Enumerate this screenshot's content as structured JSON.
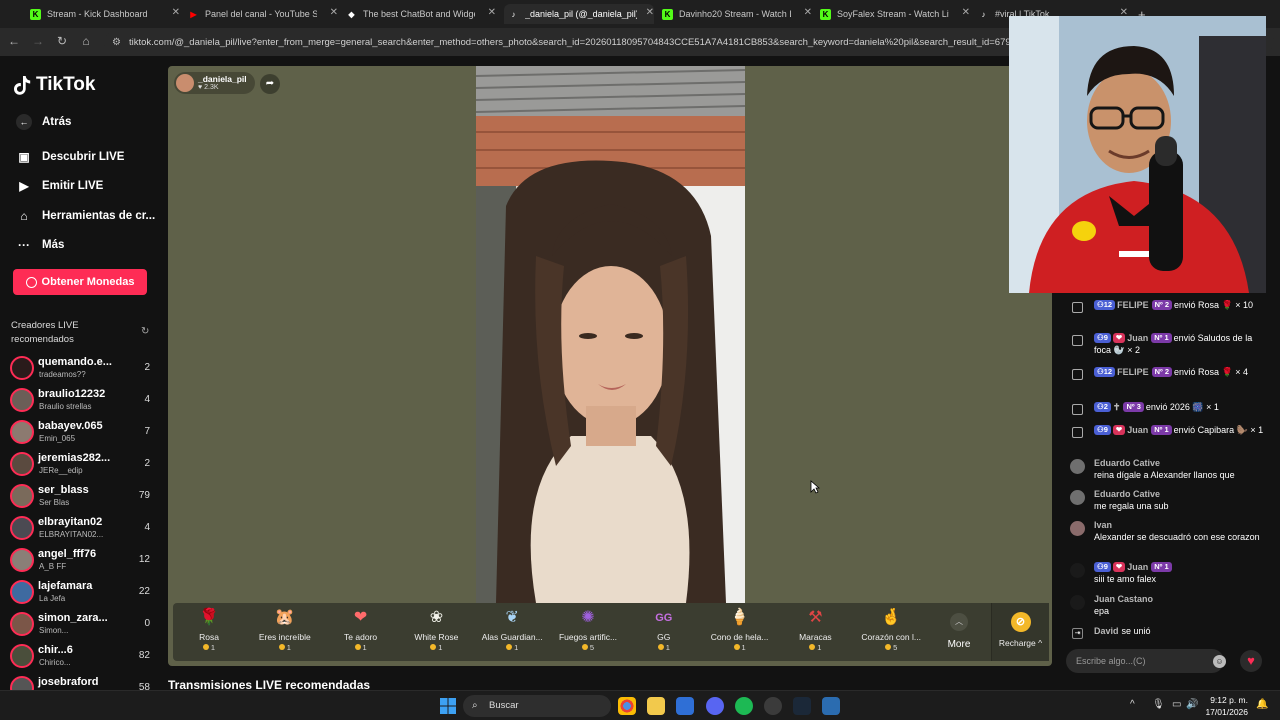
{
  "browser": {
    "tabs": [
      {
        "title": "Stream - Kick Dashboard",
        "icon": "kick-icon",
        "color": "#53fc18"
      },
      {
        "title": "Panel del canal - YouTube Studio",
        "icon": "youtube-icon",
        "color": "#ff0000"
      },
      {
        "title": "The best ChatBot and Widgets",
        "icon": "streamelements-icon",
        "color": "#ffffff"
      },
      {
        "title": "_daniela_pil (@_daniela_pil)",
        "icon": "tiktok-icon",
        "color": "#ffffff"
      },
      {
        "title": "Davinho20 Stream - Watch Live",
        "icon": "kick-icon",
        "color": "#53fc18"
      },
      {
        "title": "SoyFalex Stream - Watch Live o",
        "icon": "kick-icon",
        "color": "#53fc18"
      },
      {
        "title": "#viral | TikTok",
        "icon": "tiktok-icon",
        "color": "#ffffff"
      }
    ],
    "new_tab": "+",
    "url": "tiktok.com/@_daniela_pil/live?enter_from_merge=general_search&enter_method=others_photo&search_id=20260118095704843CCE51A7A4181CB853&search_keyword=daniela%20pil&search_result_id=679591156"
  },
  "sidebar": {
    "logo": "TikTok",
    "back": "Atrás",
    "nav": [
      {
        "label": "Descubrir LIVE",
        "icon": "live-tv-icon"
      },
      {
        "label": "Emitir LIVE",
        "icon": "video-camera-icon"
      },
      {
        "label": "Herramientas de cr...",
        "icon": "home-tools-icon"
      },
      {
        "label": "Más",
        "icon": "more-dots-icon"
      }
    ],
    "coins_button": "Obtener Monedas",
    "recommended_title": "Creadores LIVE recomendados",
    "creators": [
      {
        "name": "quemando.e...",
        "sub": "tradeamos??",
        "count": "2",
        "color": "#2a1b1b"
      },
      {
        "name": "braulio12232",
        "sub": "Braulio strellas",
        "count": "4",
        "color": "#6b5e57"
      },
      {
        "name": "babayev.065",
        "sub": "Emin_065",
        "count": "7",
        "color": "#8c7a70"
      },
      {
        "name": "jeremias282...",
        "sub": "JERe__edip",
        "count": "2",
        "color": "#5a4a3f"
      },
      {
        "name": "ser_blass",
        "sub": "Ser Blas",
        "count": "79",
        "color": "#7a6a5b"
      },
      {
        "name": "elbrayitan02",
        "sub": "ELBRAYITAN02...",
        "count": "4",
        "color": "#4b4a52"
      },
      {
        "name": "angel_fff76",
        "sub": "A_B FF",
        "count": "12",
        "color": "#8a7f77"
      },
      {
        "name": "lajefamara",
        "sub": "La Jefa",
        "count": "22",
        "color": "#3e6aa0"
      },
      {
        "name": "simon_zara...",
        "sub": "Simon...",
        "count": "0",
        "color": "#7b5648"
      },
      {
        "name": "chir...6",
        "sub": "Chirico...",
        "count": "82",
        "color": "#4a4e3b"
      },
      {
        "name": "josebraford",
        "sub": "",
        "count": "58",
        "color": "#555555"
      }
    ]
  },
  "stream": {
    "host": "_daniela_pil",
    "likes": "2.3K",
    "more_label": "More",
    "recharge_label": "Recharge",
    "gifts": [
      {
        "name": "Rosa",
        "price": "1",
        "icon": "rose-icon",
        "color": "#e53b5c"
      },
      {
        "name": "Eres increíble",
        "price": "1",
        "icon": "hamster-icon",
        "color": "#d9a066"
      },
      {
        "name": "Te adoro",
        "price": "1",
        "icon": "heart-sweater-icon",
        "color": "#ff6b6b"
      },
      {
        "name": "White Rose",
        "price": "1",
        "icon": "white-rose-icon",
        "color": "#f0f0e8"
      },
      {
        "name": "Alas Guardian...",
        "price": "1",
        "icon": "wings-icon",
        "color": "#a9d4f5"
      },
      {
        "name": "Fuegos artific...",
        "price": "5",
        "icon": "fireworks-icon",
        "color": "#a060e0"
      },
      {
        "name": "GG",
        "price": "1",
        "icon": "gg-icon",
        "color": "#c56fe0"
      },
      {
        "name": "Cono de hela...",
        "price": "1",
        "icon": "ice-cream-icon",
        "color": "#f4b6d0"
      },
      {
        "name": "Maracas",
        "price": "1",
        "icon": "maracas-icon",
        "color": "#e04545"
      },
      {
        "name": "Corazón con l...",
        "price": "5",
        "icon": "finger-heart-icon",
        "color": "#f09a7a"
      }
    ]
  },
  "below_title": "Transmisiones LIVE recomendadas",
  "chat": {
    "messages": [
      {
        "type": "gift",
        "level": "12",
        "fan": "",
        "user": "FELIPE",
        "sub": "Nº 2",
        "text": "envió Rosa 🌹 × 10"
      },
      {
        "type": "gift",
        "level": "9",
        "fan": "💗",
        "user": "Juan",
        "sub": "Nº 1",
        "text": "envió Saludos de la foca 🦭 × 2"
      },
      {
        "type": "gift",
        "level": "12",
        "fan": "",
        "user": "FELIPE",
        "sub": "Nº 2",
        "text": "envió Rosa 🌹 × 4"
      },
      {
        "type": "gift",
        "level": "2",
        "fan": "",
        "user": "✝",
        "sub": "Nº 3",
        "text": "envió 2026 🎆 × 1"
      },
      {
        "type": "gift",
        "level": "9",
        "fan": "💗",
        "user": "Juan",
        "sub": "Nº 1",
        "text": "envió Capibara 🦫 × 1"
      },
      {
        "type": "chat",
        "user": "Eduardo Cative",
        "text": "reina dígale a Alexander llanos que"
      },
      {
        "type": "chat",
        "user": "Eduardo Cative",
        "text": "me regala una sub"
      },
      {
        "type": "chat",
        "user": "Ivan",
        "text": "Alexander se descuadró con ese corazon"
      },
      {
        "type": "chat-badge",
        "level": "9",
        "fan": "💗",
        "user": "Juan",
        "sub": "Nº 1",
        "text": "siii te amo falex"
      },
      {
        "type": "chat",
        "user": "Juan Castano",
        "text": "epa"
      },
      {
        "type": "join",
        "user": "David",
        "text": "se unió"
      }
    ],
    "input_placeholder": "Escribe algo...(C)"
  },
  "taskbar": {
    "search_placeholder": "Buscar",
    "time": "9:12 p. m.",
    "date": "17/01/2026"
  }
}
